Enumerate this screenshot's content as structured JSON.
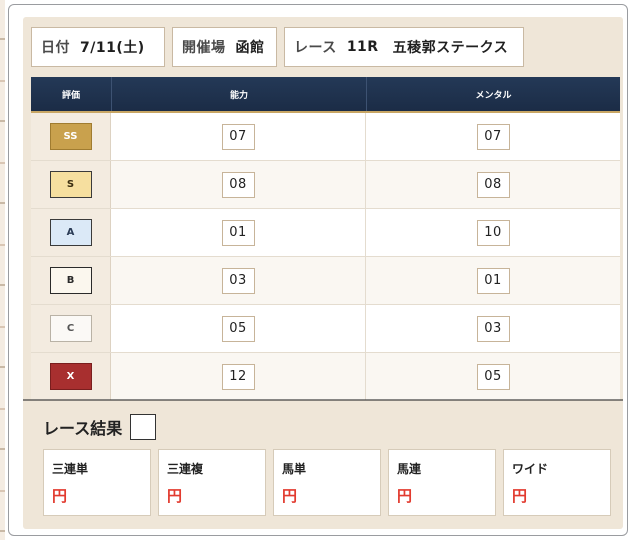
{
  "info": {
    "date_label": "日付",
    "date_value": "7/11(土)",
    "venue_label": "開催場",
    "venue_value": "函館",
    "race_label": "レース",
    "race_number": "11R",
    "race_name": "五稜郭ステークス"
  },
  "table": {
    "headers": [
      "評価",
      "能力",
      "メンタル"
    ],
    "rows": [
      {
        "grade": "SS",
        "ability": "07",
        "mental": "07"
      },
      {
        "grade": "S",
        "ability": "08",
        "mental": "08"
      },
      {
        "grade": "A",
        "ability": "01",
        "mental": "10"
      },
      {
        "grade": "B",
        "ability": "03",
        "mental": "01"
      },
      {
        "grade": "C",
        "ability": "05",
        "mental": "03"
      },
      {
        "grade": "X",
        "ability": "12",
        "mental": "05"
      }
    ]
  },
  "result": {
    "title": "レース結果",
    "payouts": [
      {
        "label": "三連単",
        "value": "円"
      },
      {
        "label": "三連複",
        "value": "円"
      },
      {
        "label": "馬単",
        "value": "円"
      },
      {
        "label": "馬連",
        "value": "円"
      },
      {
        "label": "ワイド",
        "value": "円"
      }
    ]
  },
  "colors": {
    "header_bg": "#1b2c46",
    "accent_gold": "#c8a664",
    "card_bg": "#efe6d8",
    "payout_text": "#e23b2f"
  }
}
